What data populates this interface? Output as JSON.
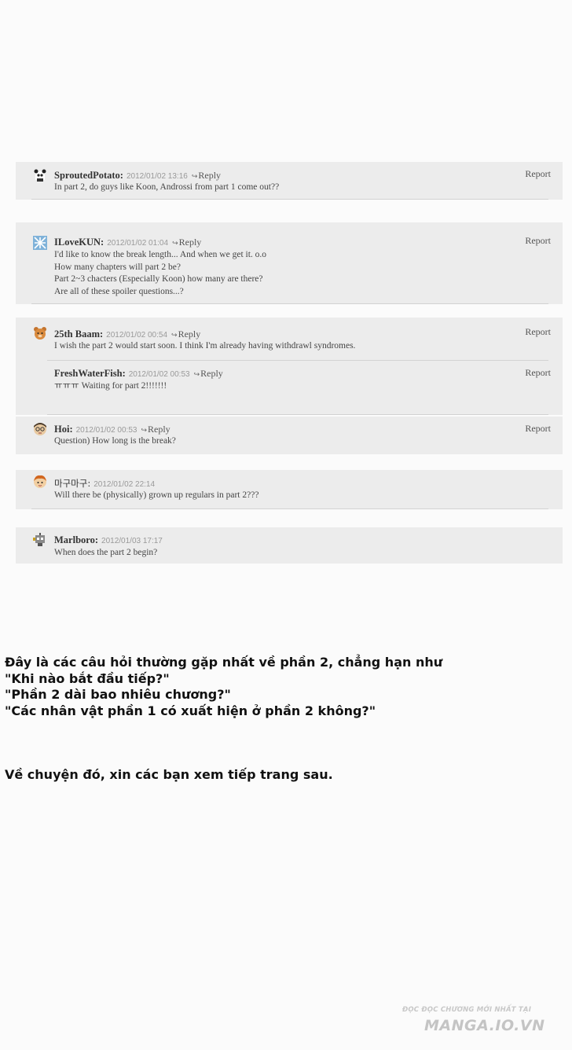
{
  "comments": [
    {
      "name": "SproutedPotato:",
      "date": "2012/01/02 13:16",
      "reply": "Reply",
      "report": "Report",
      "lines": [
        "In part 2, do guys like Koon, Androssi from part 1 come out??"
      ]
    },
    {
      "name": "ILoveKUN:",
      "date": "2012/01/02 01:04",
      "reply": "Reply",
      "report": "Report",
      "lines": [
        "I'd like to know the break length... And when we get it. o.o",
        "How many chapters will part 2 be?",
        "Part 2~3 chacters (Especially Koon) how many are there?",
        "Are all of these spoiler questions...?"
      ]
    },
    {
      "name": "25th Baam:",
      "date": "2012/01/02 00:54",
      "reply": "Reply",
      "report": "Report",
      "lines": [
        "I wish the part 2 would start soon. I think I'm already having withdrawl syndromes."
      ]
    },
    {
      "name": "FreshWaterFish:",
      "date": "2012/01/02 00:53",
      "reply": "Reply",
      "report": "Report",
      "lines": [
        "ㅠㅠㅠ Waiting for part 2!!!!!!!"
      ]
    },
    {
      "name": "Hoi:",
      "date": "2012/01/02 00:53",
      "reply": "Reply",
      "report": "Report",
      "lines": [
        "Question) How long is the break?"
      ]
    },
    {
      "name": "마구마구:",
      "date": "2012/01/02 22:14",
      "lines": [
        "Will there be (physically) grown up regulars in part 2???"
      ]
    },
    {
      "name": "Marlboro:",
      "date": "2012/01/03 17:17",
      "lines": [
        "When does the part 2 begin?"
      ]
    }
  ],
  "note": {
    "lines": [
      "Đây là các câu hỏi thường gặp nhất về phần 2, chẳng hạn như",
      "\"Khi nào bắt đầu tiếp?\"",
      "\"Phần 2 dài bao nhiêu chương?\"",
      "\"Các nhân vật phần 1 có xuất hiện ở phần 2 không?\""
    ],
    "closing": "Về chuyện đó, xin các bạn xem tiếp trang sau."
  },
  "watermark": {
    "line1": "ĐỌC ĐỌC CHƯƠNG MỚI NHẤT TẠI",
    "line2": "MANGA.IO.VN"
  },
  "icons": [
    "panda-avatar-icon",
    "blue-pattern-avatar-icon",
    "bear-avatar-icon",
    "glasses-face-avatar-icon",
    "ginger-face-avatar-icon",
    "robot-avatar-icon"
  ]
}
